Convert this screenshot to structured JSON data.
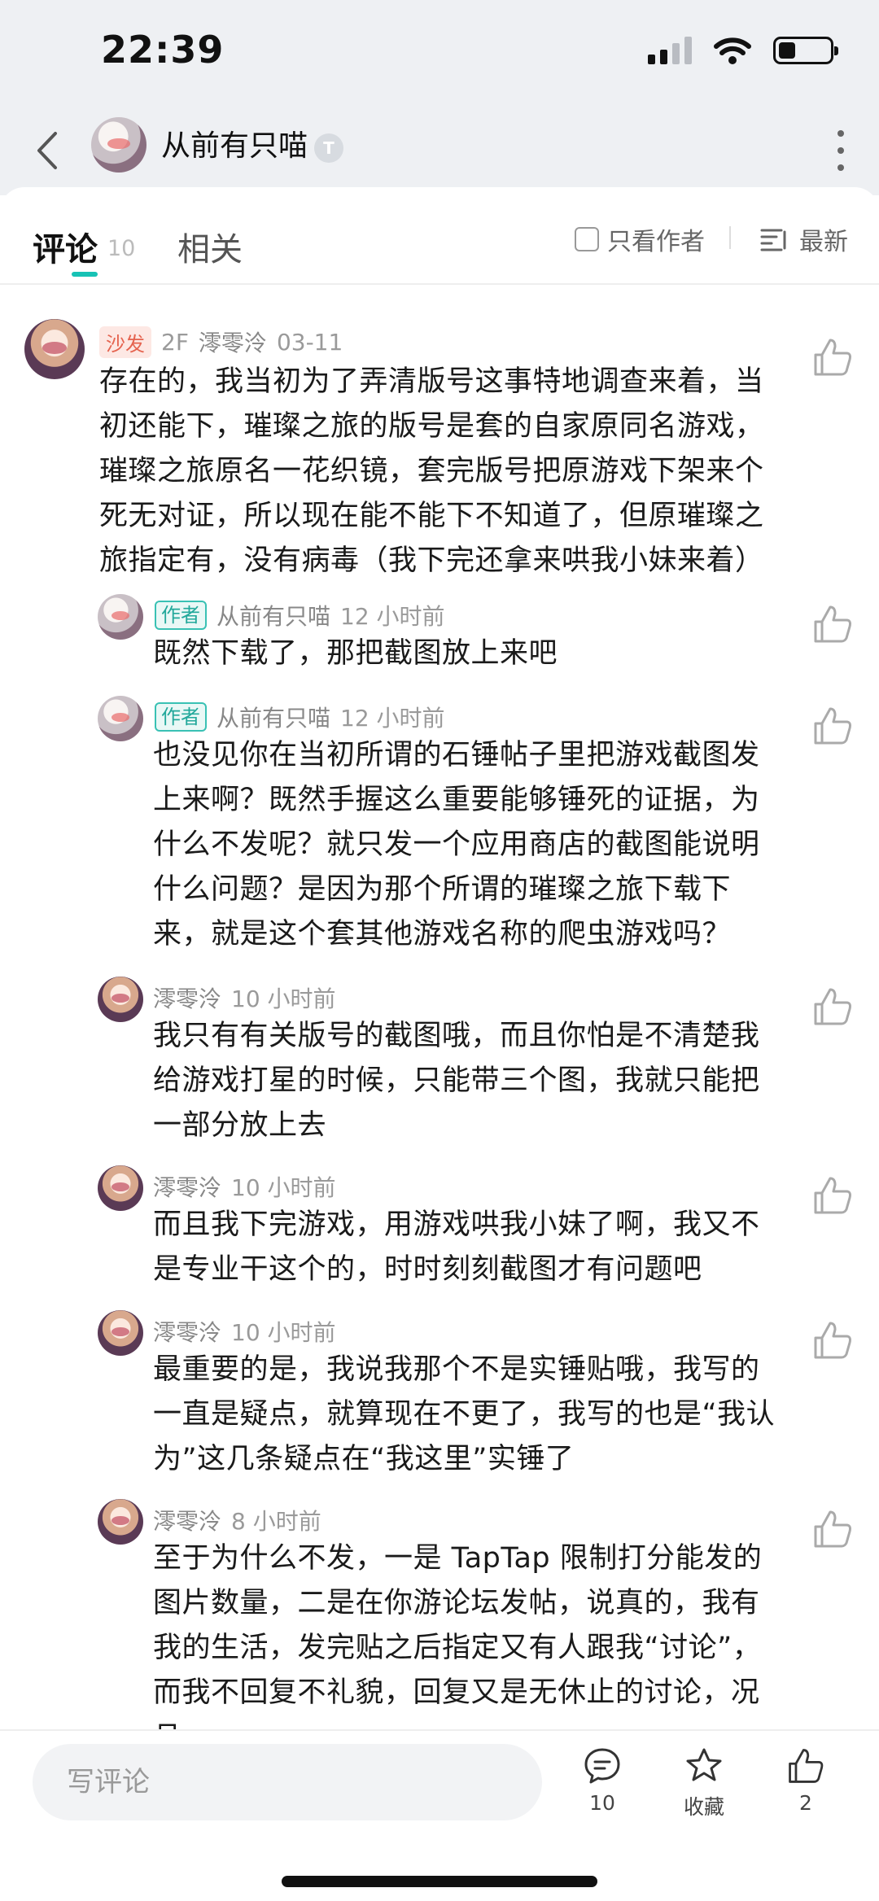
{
  "status_bar": {
    "time": "22:39"
  },
  "header": {
    "title": "从前有只喵",
    "badge": "T"
  },
  "tabs": {
    "comments_label": "评论",
    "comments_count": "10",
    "related_label": "相关",
    "author_only_label": "只看作者",
    "sort_label": "最新"
  },
  "comments": [
    {
      "sofa": "沙发",
      "floor": "2F",
      "name": "澪零泠",
      "time": "03-11",
      "text": "存在的，我当初为了弄清版号这事特地调查来着，当初还能下，璀璨之旅的版号是套的自家原同名游戏，璀璨之旅原名一花织镜，套完版号把原游戏下架来个死无对证，所以现在能不能下不知道了，但原璀璨之旅指定有，没有病毒（我下完还拿来哄我小妹来着）"
    },
    {
      "tag": "作者",
      "name": "从前有只喵",
      "time": "12 小时前",
      "text": "既然下载了，那把截图放上来吧"
    },
    {
      "tag": "作者",
      "name": "从前有只喵",
      "time": "12 小时前",
      "text": "也没见你在当初所谓的石锤帖子里把游戏截图发上来啊？既然手握这么重要能够锤死的证据，为什么不发呢？就只发一个应用商店的截图能说明什么问题？是因为那个所谓的璀璨之旅下载下来，就是这个套其他游戏名称的爬虫游戏吗？"
    },
    {
      "name": "澪零泠",
      "time": "10 小时前",
      "text": "我只有有关版号的截图哦，而且你怕是不清楚我给游戏打星的时候，只能带三个图，我就只能把一部分放上去"
    },
    {
      "name": "澪零泠",
      "time": "10 小时前",
      "text": "而且我下完游戏，用游戏哄我小妹了啊，我又不是专业干这个的，时时刻刻截图才有问题吧"
    },
    {
      "name": "澪零泠",
      "time": "10 小时前",
      "text": "最重要的是，我说我那个不是实锤贴哦，我写的一直是疑点，就算现在不更了，我写的也是“我认为”这几条疑点在“我这里”实锤了"
    },
    {
      "name": "澪零泠",
      "time": "8 小时前",
      "text": "至于为什么不发，一是 TapTap 限制打分能发的图片数量，二是在你游论坛发帖，说真的，我有我的生活，发完贴之后指定又有人跟我“讨论”，而我不回复不礼貌，回复又是无休止的讨论，况且"
    }
  ],
  "bottom_bar": {
    "input_placeholder": "写评论",
    "comment_count": "10",
    "favorite_label": "收藏",
    "like_count": "2"
  },
  "colors": {
    "accent": "#17c2b5",
    "sofa": "#e5634f",
    "background": "#ffffff",
    "header_bg": "#eef0f3"
  }
}
